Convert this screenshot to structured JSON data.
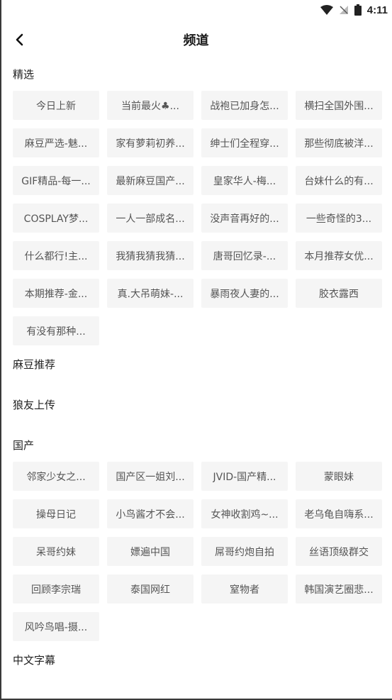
{
  "status_bar": {
    "time": "4:11"
  },
  "header": {
    "title": "频道"
  },
  "sections": [
    {
      "title": "精选",
      "items": [
        "今日上新",
        "当前最火♣...",
        "战袍已加身怎...",
        "横扫全国外围...",
        "麻豆严选-魅...",
        "家有萝莉初养...",
        "绅士们全程穿...",
        "那些彻底被洋...",
        "GIF精品-每一...",
        "最新麻豆国产...",
        "皇家华人-梅...",
        "台妹什么的有...",
        "COSPLAY梦...",
        "一人一部成名...",
        "没声音再好的...",
        "一些奇怪的3...",
        "什么都行!主...",
        "我猜我猜我猜...",
        "唐哥回忆录-...",
        "本月推荐女优...",
        "本期推荐-金...",
        "真.大吊萌妹-...",
        "暴雨夜人妻的...",
        "胶衣露西",
        "有没有那种..."
      ]
    },
    {
      "title": "麻豆推荐",
      "items": []
    },
    {
      "title": "狼友上传",
      "items": []
    },
    {
      "title": "国产",
      "items": [
        "邻家少女之...",
        "国产区一姐刘...",
        "JVID-国产精...",
        "蒙眼妹",
        "操母日记",
        "小鸟酱才不会...",
        "女神收割鸡~...",
        "老乌龟自嗨系...",
        "呆哥约妹",
        "嫖遍中国",
        "屌哥约炮自拍",
        "丝语顶级群交",
        "回顾李宗瑞",
        "泰国网红",
        "窒物者",
        "韩国演艺圈悲...",
        "风吟鸟唱-摄..."
      ]
    },
    {
      "title": "中文字幕",
      "items": []
    }
  ]
}
